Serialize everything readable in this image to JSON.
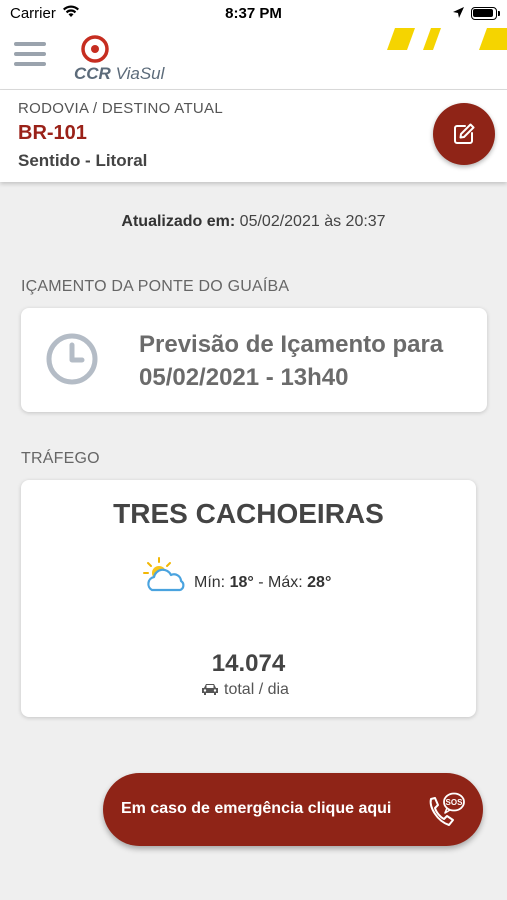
{
  "status_bar": {
    "carrier": "Carrier",
    "time": "8:37 PM"
  },
  "header": {
    "logo_brand": "CCR",
    "logo_name": "ViaSul",
    "brand_colors": {
      "red": "#9a2118",
      "stripe_yellow": "#f5d400",
      "gray": "#5c6b7a"
    }
  },
  "highway": {
    "label": "RODOVIA / DESTINO ATUAL",
    "road": "BR-101",
    "direction": "Sentido - Litoral"
  },
  "updated": {
    "label": "Atualizado em:",
    "value": "05/02/2021 às 20:37"
  },
  "bridge": {
    "section_title": "IÇAMENTO DA PONTE DO GUAÍBA",
    "line1": "Previsão de Içamento para",
    "line2": "05/02/2021 - 13h40"
  },
  "traffic": {
    "section_title": "TRÁFEGO",
    "city": "TRES CACHOEIRAS",
    "min_label": "Mín:",
    "min_value": "18°",
    "separator": "-",
    "max_label": "Máx:",
    "max_value": "28°",
    "count": "14.074",
    "count_unit": "total / dia"
  },
  "sos": {
    "label": "Em caso de emergência clique aqui",
    "icon_text": "SOS"
  },
  "icons": {
    "menu": "hamburger-icon",
    "edit": "edit-icon",
    "clock": "clock-icon",
    "weather": "partly-cloudy-icon",
    "car": "car-icon",
    "sos": "sos-phone-icon"
  }
}
